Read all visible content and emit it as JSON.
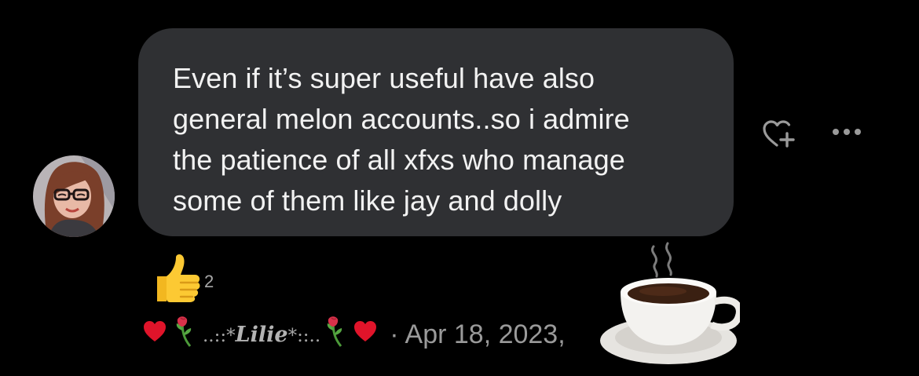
{
  "comment": {
    "text": "Even if it’s super useful have also general melon accounts..so i admire the patience of all xfxs who manage some of them like jay and dolly",
    "lines": [
      "Even if it’s super useful have also",
      "general melon accounts..so i admire",
      "the patience of all xfxs who manage",
      "some of them like jay and dolly"
    ]
  },
  "reaction": {
    "emoji": "thumbs-up",
    "count": "2"
  },
  "author": {
    "username_prefix": "..::*",
    "username_core": "Lilie",
    "username_suffix": "*::..",
    "decorations": [
      "heart",
      "wilted-rose",
      "wilted-rose",
      "heart"
    ]
  },
  "meta": {
    "separator": "·",
    "date": "Apr 18, 2023,"
  },
  "actions": {
    "like_icon": "heart-plus-icon",
    "more_icon": "more-dots-icon"
  },
  "colors": {
    "background": "#000000",
    "bubble": "#2f3033",
    "text": "#f2f2f2",
    "meta_text": "#9a9a9a",
    "heart": "#e0142a"
  }
}
